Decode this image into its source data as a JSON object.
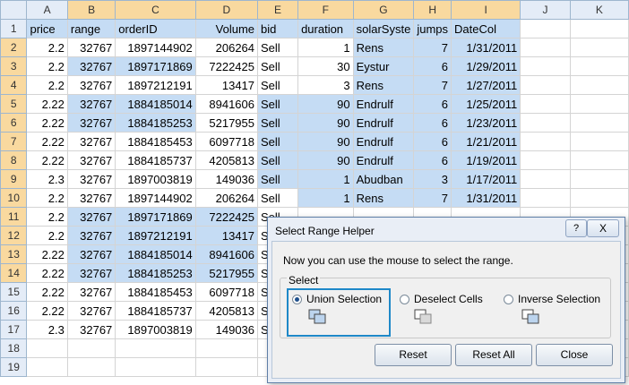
{
  "columns": [
    "",
    "A",
    "B",
    "C",
    "D",
    "E",
    "F",
    "G",
    "H",
    "I",
    "J",
    "K"
  ],
  "rows": [
    {
      "n": "1",
      "cells": [
        "price",
        "range",
        "orderID",
        "Volume",
        "bid",
        "duration",
        "solarSyste",
        "jumps",
        "DateCol",
        "",
        ""
      ]
    },
    {
      "n": "2",
      "cells": [
        "2.2",
        "32767",
        "1897144902",
        "206264",
        "Sell",
        "1",
        "Rens",
        "7",
        "1/31/2011",
        "",
        ""
      ]
    },
    {
      "n": "3",
      "cells": [
        "2.2",
        "32767",
        "1897171869",
        "7222425",
        "Sell",
        "30",
        "Eystur",
        "6",
        "1/29/2011",
        "",
        ""
      ]
    },
    {
      "n": "4",
      "cells": [
        "2.2",
        "32767",
        "1897212191",
        "13417",
        "Sell",
        "3",
        "Rens",
        "7",
        "1/27/2011",
        "",
        ""
      ]
    },
    {
      "n": "5",
      "cells": [
        "2.22",
        "32767",
        "1884185014",
        "8941606",
        "Sell",
        "90",
        "Endrulf",
        "6",
        "1/25/2011",
        "",
        ""
      ]
    },
    {
      "n": "6",
      "cells": [
        "2.22",
        "32767",
        "1884185253",
        "5217955",
        "Sell",
        "90",
        "Endrulf",
        "6",
        "1/23/2011",
        "",
        ""
      ]
    },
    {
      "n": "7",
      "cells": [
        "2.22",
        "32767",
        "1884185453",
        "6097718",
        "Sell",
        "90",
        "Endrulf",
        "6",
        "1/21/2011",
        "",
        ""
      ]
    },
    {
      "n": "8",
      "cells": [
        "2.22",
        "32767",
        "1884185737",
        "4205813",
        "Sell",
        "90",
        "Endrulf",
        "6",
        "1/19/2011",
        "",
        ""
      ]
    },
    {
      "n": "9",
      "cells": [
        "2.3",
        "32767",
        "1897003819",
        "149036",
        "Sell",
        "1",
        "Abudban",
        "3",
        "1/17/2011",
        "",
        ""
      ]
    },
    {
      "n": "10",
      "cells": [
        "2.2",
        "32767",
        "1897144902",
        "206264",
        "Sell",
        "1",
        "Rens",
        "7",
        "1/31/2011",
        "",
        ""
      ]
    },
    {
      "n": "11",
      "cells": [
        "2.2",
        "32767",
        "1897171869",
        "7222425",
        "Sell",
        "",
        "",
        "",
        "",
        "",
        ""
      ]
    },
    {
      "n": "12",
      "cells": [
        "2.2",
        "32767",
        "1897212191",
        "13417",
        "Sell",
        "",
        "",
        "",
        "",
        "",
        ""
      ]
    },
    {
      "n": "13",
      "cells": [
        "2.22",
        "32767",
        "1884185014",
        "8941606",
        "Sell",
        "",
        "",
        "",
        "",
        "",
        ""
      ]
    },
    {
      "n": "14",
      "cells": [
        "2.22",
        "32767",
        "1884185253",
        "5217955",
        "Sell",
        "",
        "",
        "",
        "",
        "",
        ""
      ]
    },
    {
      "n": "15",
      "cells": [
        "2.22",
        "32767",
        "1884185453",
        "6097718",
        "Sell",
        "",
        "",
        "",
        "",
        "",
        ""
      ]
    },
    {
      "n": "16",
      "cells": [
        "2.22",
        "32767",
        "1884185737",
        "4205813",
        "Sell",
        "",
        "",
        "",
        "",
        "",
        ""
      ]
    },
    {
      "n": "17",
      "cells": [
        "2.3",
        "32767",
        "1897003819",
        "149036",
        "Sell",
        "",
        "",
        "",
        "",
        "",
        ""
      ]
    },
    {
      "n": "18",
      "cells": [
        "",
        "",
        "",
        "",
        "",
        "",
        "",
        "",
        "",
        "",
        ""
      ]
    },
    {
      "n": "19",
      "cells": [
        "",
        "",
        "",
        "",
        "",
        "",
        "",
        "",
        "",
        "",
        ""
      ]
    }
  ],
  "dialog": {
    "title": "Select Range Helper",
    "help": "?",
    "close_x": "X",
    "message": "Now you can use the mouse to select the range.",
    "group_label": "Select",
    "options": {
      "union": "Union Selection",
      "deselect": "Deselect Cells",
      "inverse": "Inverse Selection"
    },
    "buttons": {
      "reset": "Reset",
      "reset_all": "Reset All",
      "close": "Close"
    }
  }
}
